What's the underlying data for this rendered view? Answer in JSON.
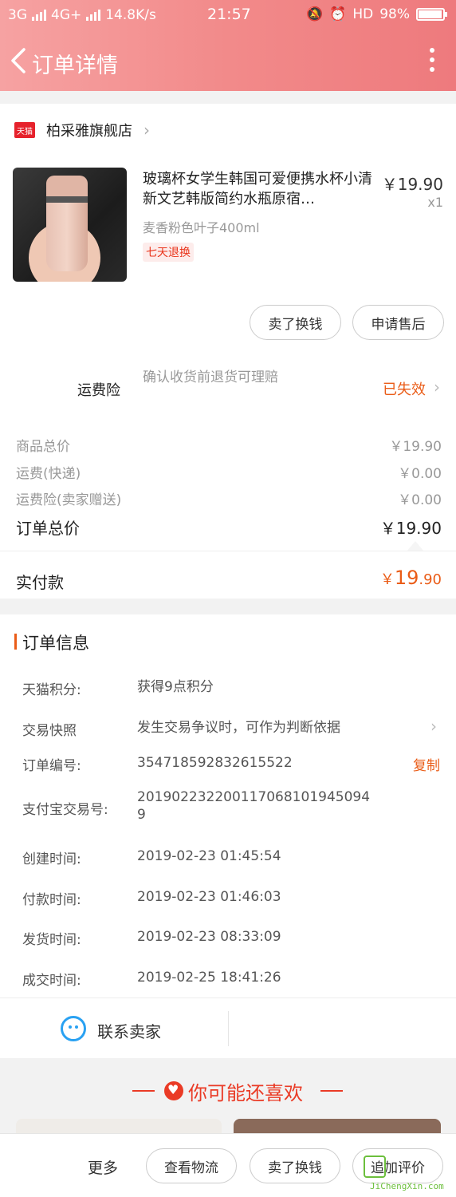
{
  "status_bar": {
    "network_left": "3G",
    "network_right": "4G+",
    "speed": "14.8K/s",
    "time": "21:57",
    "hd": "HD",
    "battery": "98%",
    "battery_level": 0.98
  },
  "header": {
    "title": "订单详情"
  },
  "shop": {
    "badge": "天猫",
    "name": "柏采雅旗舰店"
  },
  "product": {
    "title": "玻璃杯女学生韩国可爱便携水杯小清新文艺韩版简约水瓶原宿…",
    "price": "￥19.90",
    "quantity": "x1",
    "sku": "麦香粉色叶子400ml",
    "badge": "七天退换"
  },
  "actions": {
    "exchange": "卖了换钱",
    "after_sale": "申请售后"
  },
  "insurance": {
    "label": "运费险",
    "desc": "确认收货前退货可理赔",
    "status": "已失效"
  },
  "fees": [
    {
      "label": "商品总价",
      "value": "￥19.90"
    },
    {
      "label": "运费(快递)",
      "value": "￥0.00"
    },
    {
      "label": "运费险(卖家赠送)",
      "value": "￥0.00"
    }
  ],
  "order_total": {
    "label": "订单总价",
    "value": "￥19.90"
  },
  "paid": {
    "label": "实付款",
    "currency": "￥",
    "integer": "19",
    "decimal": ".90"
  },
  "order_info": {
    "title": "订单信息",
    "rows": [
      {
        "label": "天猫积分:",
        "value": "获得9点积分"
      },
      {
        "label": "交易快照",
        "value": "发生交易争议时，可作为判断依据"
      },
      {
        "label": "订单编号:",
        "value": "354718592832615522",
        "action": "复制"
      },
      {
        "label": "支付宝交易号:",
        "value": "2019022322001170681019450949"
      },
      {
        "label": "创建时间:",
        "value": "2019-02-23 01:45:54"
      },
      {
        "label": "付款时间:",
        "value": "2019-02-23 01:46:03"
      },
      {
        "label": "发货时间:",
        "value": "2019-02-23 08:33:09"
      },
      {
        "label": "成交时间:",
        "value": "2019-02-25 18:41:26"
      }
    ]
  },
  "contact": {
    "label": "联系卖家"
  },
  "recommend": {
    "title": "你可能还喜欢"
  },
  "bottom_bar": {
    "more": "更多",
    "buttons": [
      "查看物流",
      "卖了换钱",
      "追加评价"
    ]
  },
  "watermark": {
    "site": "JiChengXin.com"
  }
}
